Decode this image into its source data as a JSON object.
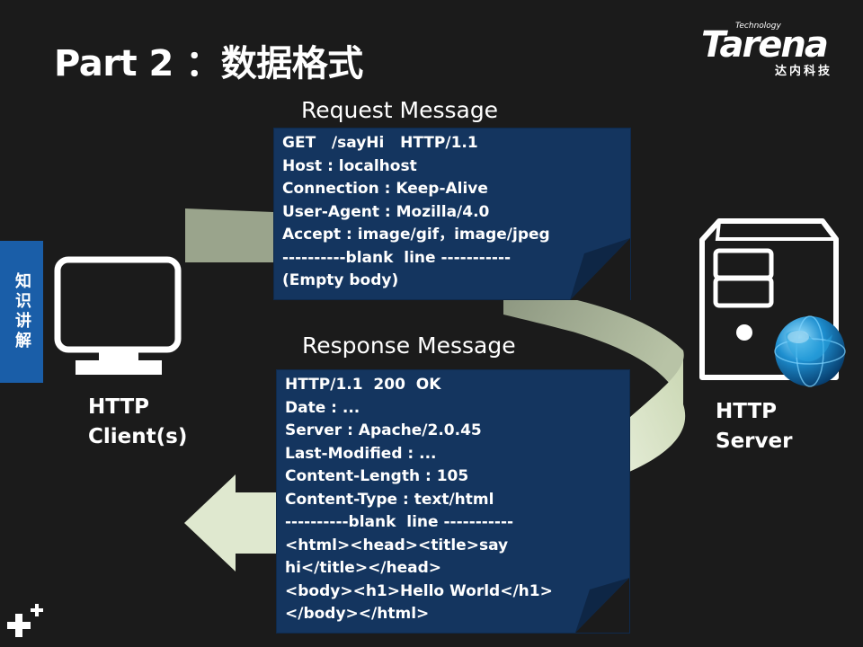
{
  "slide": {
    "title": "Part 2 ：数据格式",
    "logo": {
      "technology": "Technology",
      "brand": "Tarena",
      "subtitle": "达内科技"
    },
    "side_tab": "知识讲解"
  },
  "request": {
    "heading": "Request Message",
    "lines": [
      "GET   /sayHi   HTTP/1.1",
      "Host : localhost",
      "Connection : Keep-Alive",
      "User-Agent : Mozilla/4.0",
      "Accept : image/gif，image/jpeg",
      "----------blank  line -----------",
      "(Empty body)"
    ]
  },
  "response": {
    "heading": "Response Message",
    "lines": [
      "HTTP/1.1  200  OK",
      "Date : ...",
      "Server : Apache/2.0.45",
      "Last-Modified : ...",
      "Content-Length : 105",
      "Content-Type : text/html",
      "----------blank  line -----------",
      "<html><head><title>say",
      "hi</title></head>",
      "<body><h1>Hello World</h1>",
      "</body></html>"
    ]
  },
  "client": {
    "line1": "HTTP",
    "line2": "Client(s)"
  },
  "server": {
    "line1": "HTTP",
    "line2": "Server"
  },
  "colors": {
    "background": "#1b1b1b",
    "message_box": "#14355f",
    "arrow": "#d8e2c6",
    "side_tab": "#1a5ea8"
  }
}
